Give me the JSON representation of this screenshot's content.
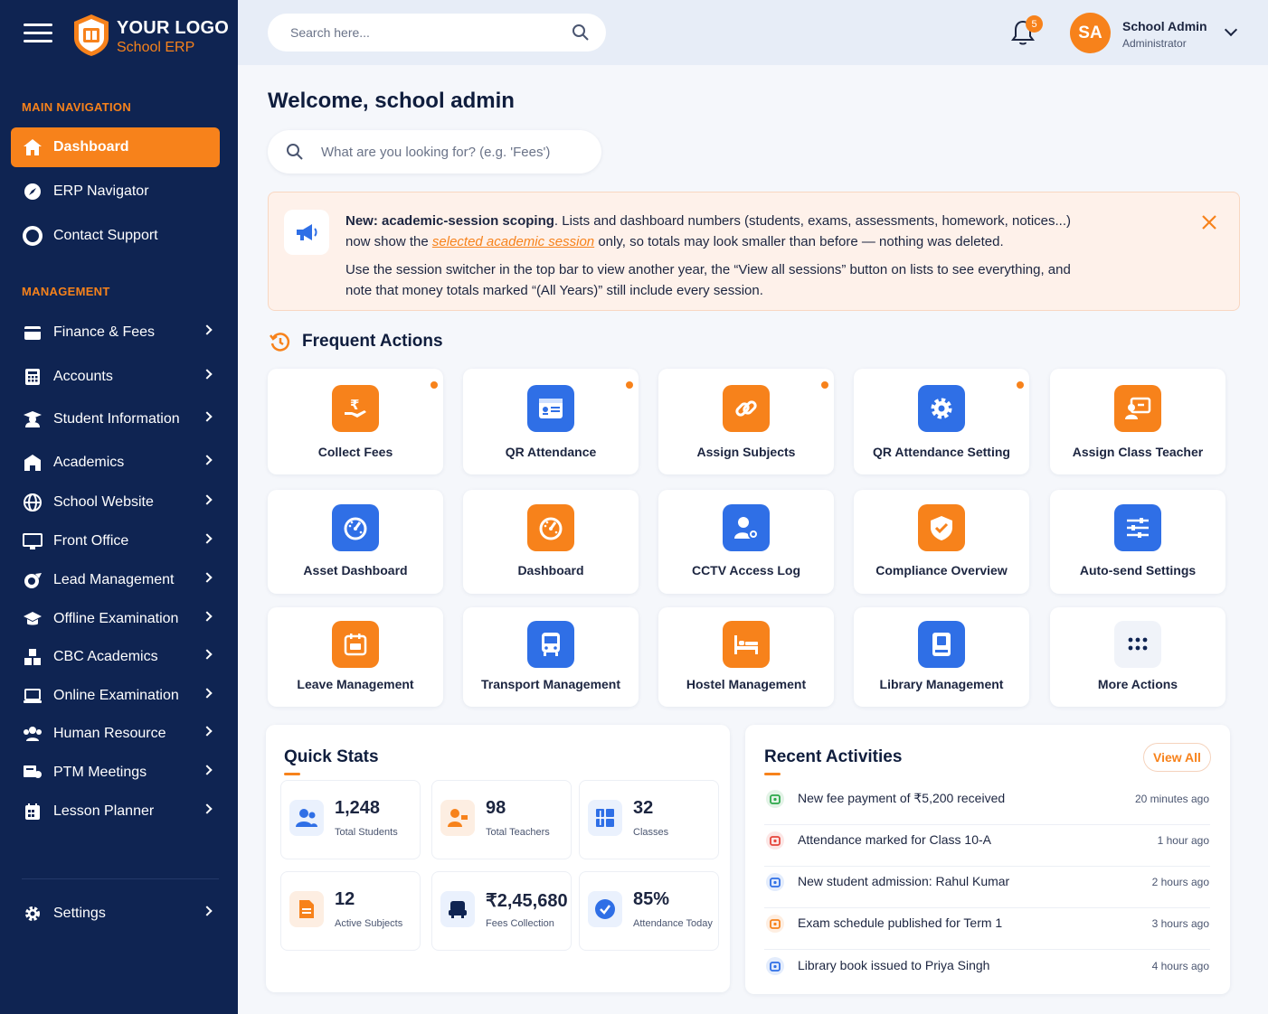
{
  "brand": {
    "title": "YOUR LOGO",
    "subtitle": "School ERP"
  },
  "sidebar": {
    "main_section": "MAIN NAVIGATION",
    "main_items": [
      {
        "label": "Dashboard",
        "icon": "home-icon",
        "active": true
      },
      {
        "label": "ERP Navigator",
        "icon": "compass-icon"
      },
      {
        "label": "Contact Support",
        "icon": "support-icon"
      }
    ],
    "management_section": "MANAGEMENT",
    "management_items": [
      {
        "label": "Finance & Fees",
        "icon": "wallet-icon"
      },
      {
        "label": "Accounts",
        "icon": "calculator-icon"
      },
      {
        "label": "Student Information",
        "icon": "student-icon"
      },
      {
        "label": "Academics",
        "icon": "school-icon"
      },
      {
        "label": "School Website",
        "icon": "globe-icon"
      },
      {
        "label": "Front Office",
        "icon": "monitor-icon"
      },
      {
        "label": "Lead Management",
        "icon": "funnel-icon"
      },
      {
        "label": "Offline Examination",
        "icon": "graduation-cap-icon"
      },
      {
        "label": "CBC Academics",
        "icon": "cubes-icon"
      },
      {
        "label": "Online Examination",
        "icon": "laptop-icon"
      },
      {
        "label": "Human Resource",
        "icon": "users-icon"
      },
      {
        "label": "PTM Meetings",
        "icon": "meeting-icon"
      },
      {
        "label": "Lesson Planner",
        "icon": "planner-icon"
      }
    ],
    "settings": {
      "label": "Settings",
      "icon": "gear-icon"
    }
  },
  "header": {
    "search_placeholder": "Search here...",
    "notification_count": "5",
    "user": {
      "initials": "SA",
      "name": "School Admin",
      "role": "Administrator"
    }
  },
  "main": {
    "welcome": "Welcome, school admin",
    "search_placeholder": "What are you looking for? (e.g. 'Fees')",
    "notice": {
      "bold": "New: academic-session scoping",
      "line1_rest": ". Lists and dashboard numbers (students, exams, assessments, homework, notices...)",
      "line2_pre": "now show the ",
      "line2_highlight": "selected academic session",
      "line2_post": " only, so totals may look smaller than before — nothing was deleted.",
      "para2": "Use the session switcher in the top bar to view another year, the “View all sessions” button on lists to see everything, and note that money totals marked “(All Years)” still include every session."
    },
    "frequent_actions_title": "Frequent Actions",
    "actions": [
      {
        "label": "Collect Fees",
        "icon": "rupee-hand-icon",
        "color": "#f7821b",
        "dot": true
      },
      {
        "label": "QR Attendance",
        "icon": "id-card-icon",
        "color": "#2f6fe6",
        "dot": true
      },
      {
        "label": "Assign Subjects",
        "icon": "link-icon",
        "color": "#f7821b",
        "dot": true
      },
      {
        "label": "QR Attendance Setting",
        "icon": "gear-icon",
        "color": "#2f6fe6",
        "dot": true
      },
      {
        "label": "Assign Class Teacher",
        "icon": "teacher-board-icon",
        "color": "#f7821b",
        "dot": false
      },
      {
        "label": "Asset Dashboard",
        "icon": "gauge-icon",
        "color": "#2f6fe6",
        "dot": false
      },
      {
        "label": "Dashboard",
        "icon": "gauge-icon",
        "color": "#f7821b",
        "dot": false
      },
      {
        "label": "CCTV Access Log",
        "icon": "user-settings-icon",
        "color": "#2f6fe6",
        "dot": false
      },
      {
        "label": "Compliance Overview",
        "icon": "shield-check-icon",
        "color": "#f7821b",
        "dot": false
      },
      {
        "label": "Auto-send Settings",
        "icon": "sliders-icon",
        "color": "#2f6fe6",
        "dot": false
      },
      {
        "label": "Leave Management",
        "icon": "calendar-icon",
        "color": "#f7821b",
        "dot": false
      },
      {
        "label": "Transport Management",
        "icon": "bus-icon",
        "color": "#2f6fe6",
        "dot": false
      },
      {
        "label": "Hostel Management",
        "icon": "bed-icon",
        "color": "#f7821b",
        "dot": false
      },
      {
        "label": "Library Management",
        "icon": "book-icon",
        "color": "#2f6fe6",
        "dot": false
      },
      {
        "label": "More Actions",
        "icon": "dots-grid-icon",
        "color": "#f0f3f9",
        "dot": false
      }
    ],
    "quick_stats": {
      "title": "Quick Stats",
      "items": [
        {
          "value": "1,248",
          "label": "Total Students",
          "icon": "users-icon"
        },
        {
          "value": "98",
          "label": "Total Teachers",
          "icon": "teacher-icon"
        },
        {
          "value": "32",
          "label": "Classes",
          "icon": "grid-icon"
        },
        {
          "value": "12",
          "label": "Active Subjects",
          "icon": "document-icon"
        },
        {
          "value": "₹2,45,680",
          "label": "Fees Collection",
          "icon": "wallet-icon"
        },
        {
          "value": "85%",
          "label": "Attendance Today",
          "icon": "check-circle-icon"
        }
      ]
    },
    "recent_activities": {
      "title": "Recent Activities",
      "view_all": "View All",
      "items": [
        {
          "text": "New fee payment of ₹5,200 received",
          "time": "20 minutes ago",
          "icon": "calendar-check-icon",
          "color": "#2ca84a"
        },
        {
          "text": "Attendance marked for Class 10-A",
          "time": "1 hour ago",
          "icon": "attendance-icon",
          "color": "#e5453b"
        },
        {
          "text": "New student admission: Rahul Kumar",
          "time": "2 hours ago",
          "icon": "user-icon",
          "color": "#2f6fe6"
        },
        {
          "text": "Exam schedule published for Term 1",
          "time": "3 hours ago",
          "icon": "calendar-icon",
          "color": "#f7821b"
        },
        {
          "text": "Library book issued to Priya Singh",
          "time": "4 hours ago",
          "icon": "book-icon",
          "color": "#2f6fe6"
        }
      ]
    }
  }
}
